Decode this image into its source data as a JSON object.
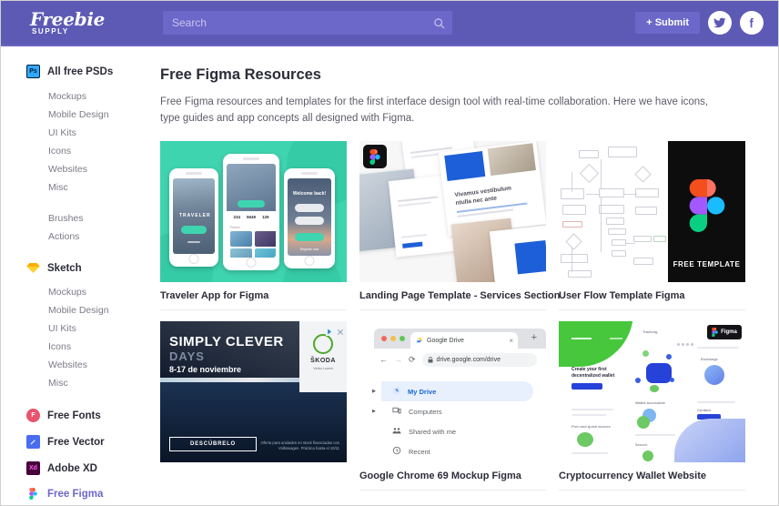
{
  "header": {
    "logo_main": "Freebie",
    "logo_sub": "SUPPLY",
    "search_placeholder": "Search",
    "search_value": "",
    "search_icon": "search-icon",
    "submit_label": "+ Submit",
    "twitter_icon": "twitter-icon",
    "facebook_icon": "facebook-icon",
    "bg_color": "#5d5ab5"
  },
  "sidebar": {
    "sections": [
      {
        "icon": "photoshop-icon",
        "label": "All free PSDs",
        "active": false,
        "items": [
          "Mockups",
          "Mobile Design",
          "UI Kits",
          "Icons",
          "Websites",
          "Misc"
        ],
        "extra_items": [
          "Brushes",
          "Actions"
        ]
      },
      {
        "icon": "sketch-icon",
        "label": "Sketch",
        "active": false,
        "items": [
          "Mockups",
          "Mobile Design",
          "UI Kits",
          "Icons",
          "Websites",
          "Misc"
        ],
        "extra_items": []
      }
    ],
    "links": [
      {
        "icon": "free-fonts-icon",
        "label": "Free Fonts",
        "active": false
      },
      {
        "icon": "free-vector-icon",
        "label": "Free Vector",
        "active": false
      },
      {
        "icon": "adobe-xd-icon",
        "label": "Adobe XD",
        "active": false
      },
      {
        "icon": "figma-icon",
        "label": "Free Figma",
        "active": true
      }
    ],
    "active_color": "#6c68c9"
  },
  "main": {
    "title": "Free Figma Resources",
    "description": "Free Figma resources and templates for the first interface design tool with real-time collaboration. Here we have icons, type guides and app concepts all designed with Figma.",
    "cards": [
      {
        "title": "Traveler App for Figma",
        "thumb": "traveler-app-thumb"
      },
      {
        "title": "Landing Page Template - Services Section",
        "thumb": "landing-page-thumb"
      },
      {
        "title": "User Flow Template Figma",
        "thumb": "user-flow-thumb"
      },
      {
        "title": "",
        "thumb": "skoda-ad-banner"
      },
      {
        "title": "Google Chrome 69 Mockup Figma",
        "thumb": "chrome-mockup-thumb"
      },
      {
        "title": "Cryptocurrency Wallet Website",
        "thumb": "crypto-wallet-thumb"
      }
    ]
  },
  "thumbs": {
    "traveler": {
      "screen1_label": "TRAVELER",
      "screen3_label": "Welcome back!"
    },
    "landing": {
      "headline": "Vivamus vestibulum\nntulla nec ante"
    },
    "userflow": {
      "free_template_label": "FREE TEMPLATE"
    },
    "skoda": {
      "title": "SIMPLY CLEVER",
      "subtitle": "DAYS",
      "date": "8-17 de noviembre",
      "cta": "DESCÚBRELO",
      "brand": "ŠKODA",
      "brand_sub": "Verbo Lucent",
      "fine_print": "Oferta para unidades en stock financiadas con Volkswagen. Práctica hasta el 10/11",
      "adchoices_icon": "adchoices-icon",
      "close_icon": "close-icon"
    },
    "chrome": {
      "tab_title": "Google Drive",
      "url": "drive.google.com/drive",
      "url_domain": "drive.google.com",
      "url_path": "/drive",
      "back_icon": "back-arrow-icon",
      "forward_icon": "forward-arrow-icon",
      "reload_icon": "reload-icon",
      "lock_icon": "lock-icon",
      "close_tab_icon": "close-tab-icon",
      "new_tab_icon": "new-tab-icon",
      "rows": [
        {
          "label": "My Drive",
          "icon": "drive-icon",
          "selected": true
        },
        {
          "label": "Computers",
          "icon": "computer-icon",
          "selected": false
        },
        {
          "label": "Shared with me",
          "icon": "people-icon",
          "selected": false
        },
        {
          "label": "Recent",
          "icon": "clock-icon",
          "selected": false
        }
      ]
    },
    "crypto": {
      "headline": "Create your first\ndecentralized wallet",
      "figma_badge": "Figma",
      "sec2": "Wallet accessible",
      "sec3": "Free and quick access",
      "sec4": "Secure",
      "sec5": "Exchange",
      "sec6": "Contact"
    }
  }
}
